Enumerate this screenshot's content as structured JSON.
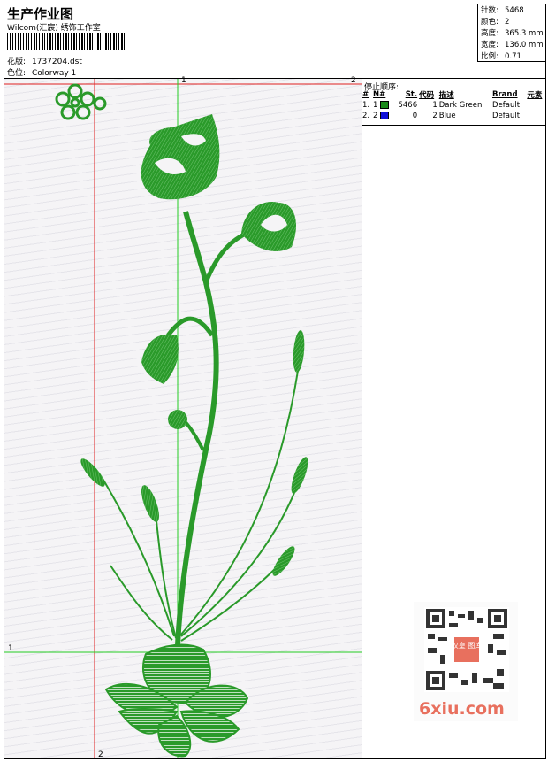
{
  "header": {
    "title": "生产作业图",
    "subtitle": "Wilcom(汇宸) 绣饰工作室",
    "design_label": "花版:",
    "design_value": "1737204.dst",
    "colorway_label": "色位:",
    "colorway_value": "Colorway 1"
  },
  "stats": {
    "stitches_label": "针数:",
    "stitches_value": "5468",
    "colors_label": "颜色:",
    "colors_value": "2",
    "height_label": "高度:",
    "height_value": "365.3 mm",
    "width_label": "宽度:",
    "width_value": "136.0 mm",
    "scale_label": "比例:",
    "scale_value": "0.71"
  },
  "stop_sequence": {
    "title": "停止顺序:",
    "columns": [
      "#",
      "N#",
      "St.",
      "代码",
      "描述",
      "Brand",
      "元素"
    ],
    "rows": [
      {
        "num": "1.",
        "n": "1",
        "color": "#1a8a1a",
        "st": "5466",
        "code": "1",
        "desc": "Dark Green",
        "brand": "Default"
      },
      {
        "num": "2.",
        "n": "2",
        "color": "#1010d8",
        "st": "0",
        "code": "2",
        "desc": "Blue",
        "brand": "Default"
      }
    ]
  },
  "guides": {
    "label_top": "1",
    "label_top_right": "2",
    "label_left": "1",
    "label_bottom": "2"
  },
  "watermark": {
    "text": "6xiu.com",
    "badge": "汉皇 图库"
  },
  "colors": {
    "thread_green": "#2a9a2a",
    "guide_red": "#e02020",
    "guide_green": "#22cc22"
  }
}
